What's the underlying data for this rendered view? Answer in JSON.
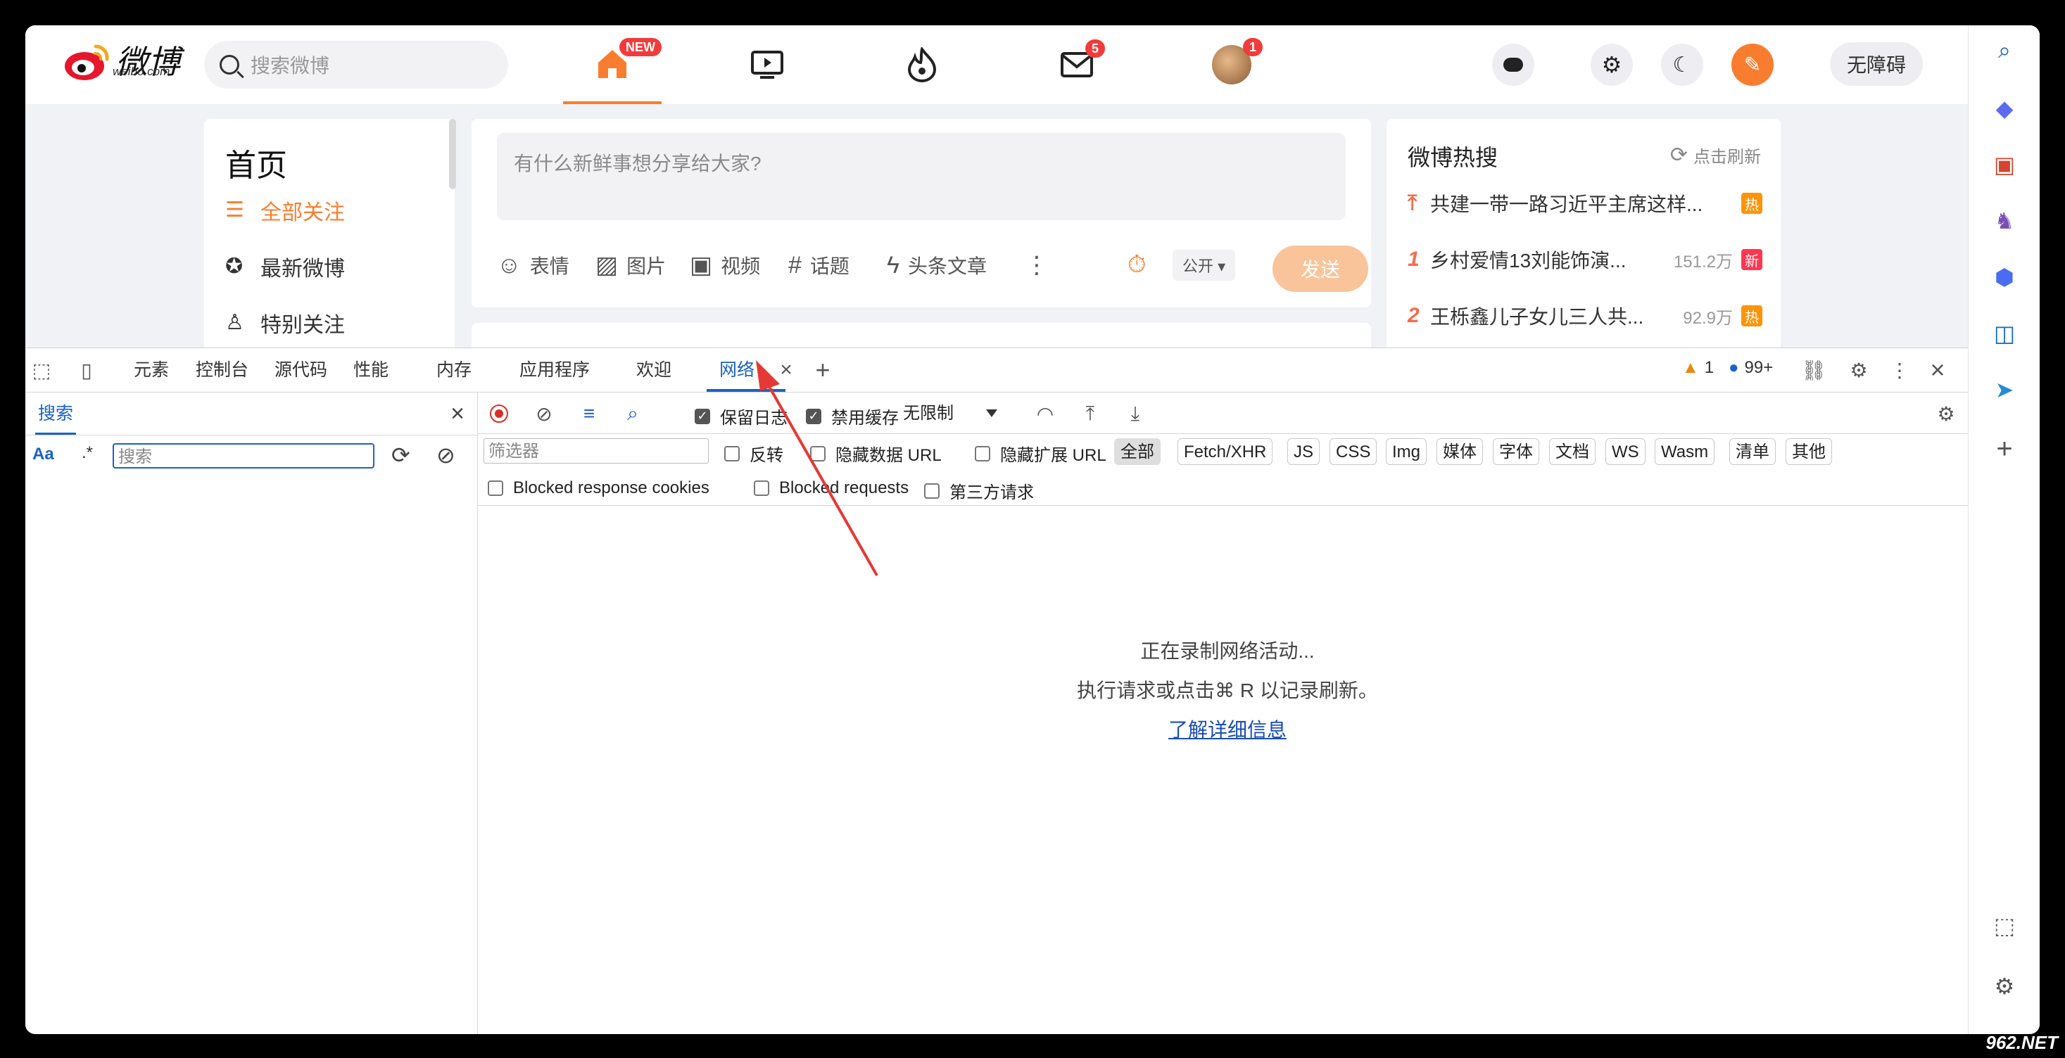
{
  "watermark_top": "962.NET",
  "watermark_bottom": "962.NET",
  "weibo": {
    "logo_text": "微博",
    "logo_sub": "weibo.com",
    "search_placeholder": "搜索微博",
    "nav": [
      {
        "name": "home",
        "badge": "NEW"
      },
      {
        "name": "video",
        "badge": ""
      },
      {
        "name": "hot",
        "badge": ""
      },
      {
        "name": "messages",
        "badge": "5"
      },
      {
        "name": "profile",
        "badge": "1"
      }
    ],
    "accessibility_label": "无障碍",
    "left": {
      "title": "首页",
      "items": [
        "全部关注",
        "最新微博",
        "特别关注"
      ]
    },
    "compose": {
      "placeholder": "有什么新鲜事想分享给大家?",
      "tools": [
        "表情",
        "图片",
        "视频",
        "话题",
        "头条文章"
      ],
      "visibility": "公开",
      "send": "发送"
    },
    "hot": {
      "title": "微博热搜",
      "refresh": "点击刷新",
      "rows": [
        {
          "rank": "",
          "text": "共建一带一路习近平主席这样...",
          "num": "",
          "tag": "热"
        },
        {
          "rank": "1",
          "text": "乡村爱情13刘能饰演...",
          "num": "151.2万",
          "tag": "新"
        },
        {
          "rank": "2",
          "text": "王栎鑫儿子女儿三人共...",
          "num": "92.9万",
          "tag": "热"
        }
      ]
    }
  },
  "devtools": {
    "tabs": [
      "元素",
      "控制台",
      "源代码",
      "性能",
      "内存",
      "应用程序",
      "欢迎",
      "网络"
    ],
    "active_tab": "网络",
    "warning_count": "1",
    "issue_count": "99+",
    "left_tab": "搜索",
    "left_aa": "Aa",
    "left_regex": ".*",
    "left_search_placeholder": "搜索",
    "preserve_log": "保留日志",
    "disable_cache": "禁用缓存",
    "throttle": "无限制",
    "filter_placeholder": "筛选器",
    "invert": "反转",
    "hide_data_urls": "隐藏数据 URL",
    "hide_ext_urls": "隐藏扩展 URL",
    "chips": [
      "全部",
      "Fetch/XHR",
      "JS",
      "CSS",
      "Img",
      "媒体",
      "字体",
      "文档",
      "WS",
      "Wasm",
      "清单",
      "其他"
    ],
    "blocked_cookies": "Blocked response cookies",
    "blocked_requests": "Blocked requests",
    "third_party": "第三方请求",
    "empty_line1": "正在录制网络活动...",
    "empty_line2": "执行请求或点击⌘ R 以记录刷新。",
    "empty_link": "了解详细信息"
  }
}
